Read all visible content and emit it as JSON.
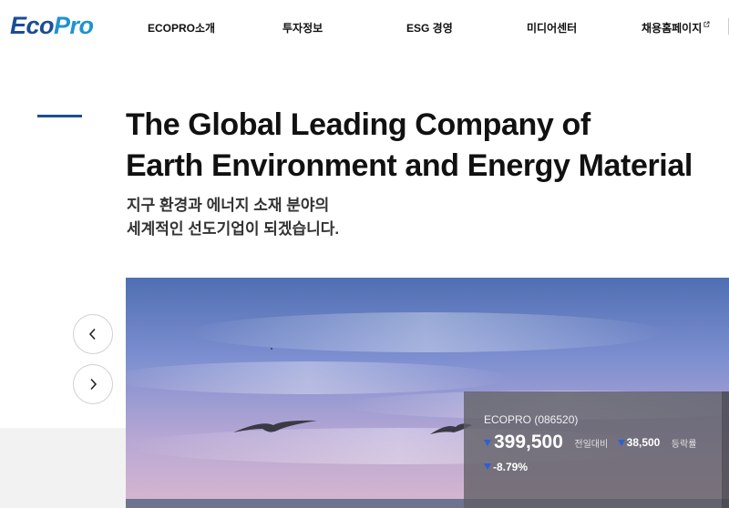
{
  "logo": {
    "part1": "Eco",
    "part2": "Pro"
  },
  "nav": {
    "items": [
      {
        "label": "ECOPRO소개"
      },
      {
        "label": "투자정보"
      },
      {
        "label": "ESG 경영"
      },
      {
        "label": "미디어센터"
      },
      {
        "label": "채용홈페이지"
      }
    ]
  },
  "hero": {
    "title_line1": "The Global Leading Company of",
    "title_line2": "Earth Environment and Energy Material",
    "subtitle_line1": "지구 환경과 에너지 소재 분야의",
    "subtitle_line2": "세계적인 선도기업이 되겠습니다."
  },
  "stock": {
    "name": "ECOPRO (086520)",
    "price": "399,500",
    "change_label": "전일대비",
    "change": "38,500",
    "change_suffix": "등락률",
    "percent": "-8.79%"
  },
  "colors": {
    "brand": "#1b4d95",
    "accent": "#1e93d1",
    "down": "#2c5fd6"
  }
}
